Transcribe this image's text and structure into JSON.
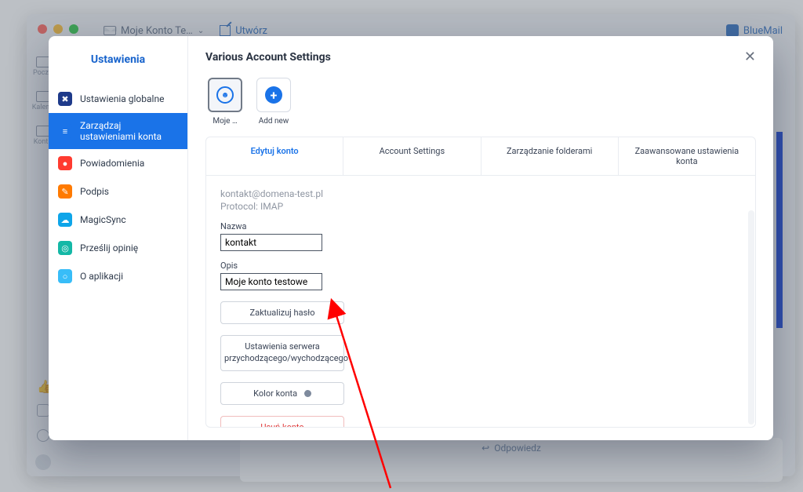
{
  "bg": {
    "account_dropdown": "Moje Konto Te…",
    "compose": "Utwórz",
    "brand": "BlueMail",
    "rail": {
      "mail": "Pocz…",
      "calendar": "Kalen…",
      "contacts": "Kont…"
    },
    "reply": "Odpowiedz"
  },
  "modal": {
    "sidebar_title": "Ustawienia",
    "sidebar": [
      {
        "label": "Ustawienia globalne"
      },
      {
        "label": "Zarządzaj ustawieniami konta"
      },
      {
        "label": "Powiadomienia"
      },
      {
        "label": "Podpis"
      },
      {
        "label": "MagicSync"
      },
      {
        "label": "Prześlij opinię"
      },
      {
        "label": "O aplikacji"
      }
    ],
    "header": "Various Account Settings",
    "chips": {
      "selected": "Moje …",
      "add": "Add new"
    },
    "tabs": [
      "Edytuj konto",
      "Account Settings",
      "Zarządzanie folderami",
      "Zaawansowane ustawienia konta"
    ],
    "edit": {
      "email": "kontakt@domena-test.pl",
      "protocol_line": "Protocol: IMAP",
      "name_label": "Nazwa",
      "name_value": "kontakt",
      "desc_label": "Opis",
      "desc_value": "Moje konto testowe",
      "update_password": "Zaktualizuj hasło",
      "server_settings": "Ustawienia serwera przychodzącego/wychodzącego",
      "account_color": "Kolor konta",
      "delete_account": "Usuń konto"
    }
  }
}
